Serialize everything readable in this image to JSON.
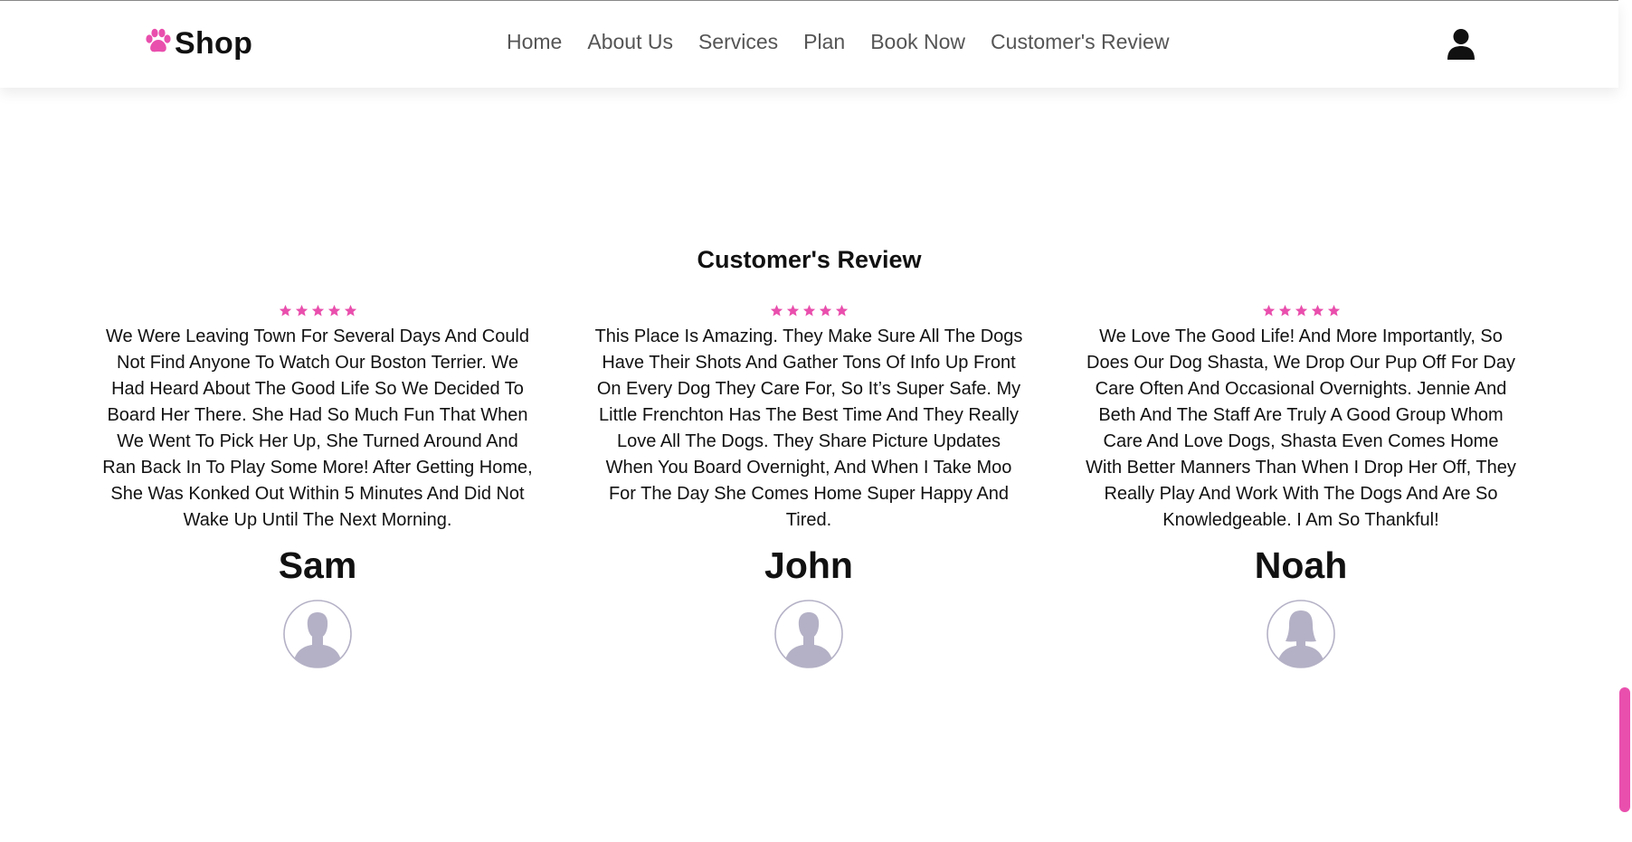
{
  "header": {
    "brand_name": "Shop",
    "nav": [
      "Home",
      "About Us",
      "Services",
      "Plan",
      "Book Now",
      "Customer's Review"
    ]
  },
  "colors": {
    "accent": "#e94fad",
    "avatar_fill": "#b4b1c6",
    "text": "#111111",
    "nav_text": "#555555"
  },
  "icons": {
    "brand": "paw-icon",
    "user": "user-icon",
    "rating": "star-icon",
    "avatar": "person-silhouette-icon"
  },
  "reviews_section": {
    "title": "Customer's Review",
    "reviews": [
      {
        "rating": 5,
        "text": "We Were Leaving Town For Several Days And Could Not Find Anyone To Watch Our Boston Terrier. We Had Heard About The Good Life So We Decided To Board Her There. She Had So Much Fun That When We Went To Pick Her Up, She Turned Around And Ran Back In To Play Some More! After Getting Home, She Was Konked Out Within 5 Minutes And Did Not Wake Up Until The Next Morning.",
        "name": "Sam",
        "avatar": "male"
      },
      {
        "rating": 5,
        "text": "This Place Is Amazing. They Make Sure All The Dogs Have Their Shots And Gather Tons Of Info Up Front On Every Dog They Care For, So It’s Super Safe. My Little Frenchton Has The Best Time And They Really Love All The Dogs. They Share Picture Updates When You Board Overnight, And When I Take Moo For The Day She Comes Home Super Happy And Tired.",
        "name": "John",
        "avatar": "male"
      },
      {
        "rating": 5,
        "text": "We Love The Good Life! And More Importantly, So Does Our Dog Shasta, We Drop Our Pup Off For Day Care Often And Occasional Overnights. Jennie And Beth And The Staff Are Truly A Good Group Whom Care And Love Dogs, Shasta Even Comes Home With Better Manners Than When I Drop Her Off, They Really Play And Work With The Dogs And Are So Knowledgeable. I Am So Thankful!",
        "name": "Noah",
        "avatar": "female"
      }
    ]
  }
}
